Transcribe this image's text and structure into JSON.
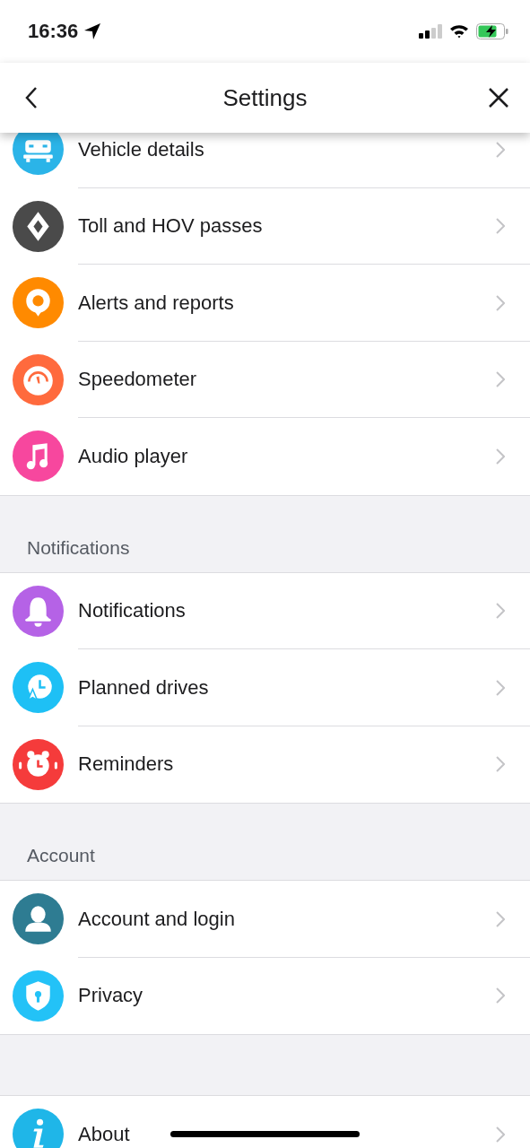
{
  "status_bar": {
    "time": "16:36"
  },
  "nav": {
    "title": "Settings"
  },
  "sections": [
    {
      "items": [
        {
          "label": "Vehicle details",
          "kind": "car",
          "color": "#2bb4e8"
        },
        {
          "label": "Toll and HOV passes",
          "kind": "diamond",
          "color": "#4a4a4a"
        },
        {
          "label": "Alerts and reports",
          "kind": "pin",
          "color": "#ff8a00"
        },
        {
          "label": "Speedometer",
          "kind": "gauge",
          "color": "#ff6a3d"
        },
        {
          "label": "Audio player",
          "kind": "music",
          "color": "#f7479e"
        }
      ]
    },
    {
      "header": "Notifications",
      "items": [
        {
          "label": "Notifications",
          "kind": "bell",
          "color": "#b562e6"
        },
        {
          "label": "Planned drives",
          "kind": "clock",
          "color": "#1ec0f5"
        },
        {
          "label": "Reminders",
          "kind": "alarm",
          "color": "#f53b3b"
        }
      ]
    },
    {
      "header": "Account",
      "items": [
        {
          "label": "Account and login",
          "kind": "person",
          "color": "#2e7c92"
        },
        {
          "label": "Privacy",
          "kind": "shield",
          "color": "#23c2f7"
        }
      ]
    },
    {
      "items": [
        {
          "label": "About",
          "kind": "info",
          "color": "#1fb6e8"
        }
      ]
    }
  ]
}
